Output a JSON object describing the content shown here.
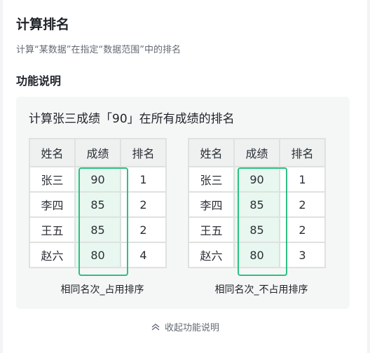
{
  "header": {
    "title": "计算排名",
    "subtitle": "计算“某数据”在指定“数据范围”中的排名"
  },
  "section": {
    "title": "功能说明"
  },
  "example": {
    "title": "计算张三成绩「90」在所有成绩的排名",
    "headers": [
      "姓名",
      "成绩",
      "排名"
    ],
    "table1": {
      "caption": "相同名次_占用排序",
      "rows": [
        [
          "张三",
          "90",
          "1"
        ],
        [
          "李四",
          "85",
          "2"
        ],
        [
          "王五",
          "85",
          "2"
        ],
        [
          "赵六",
          "80",
          "4"
        ]
      ]
    },
    "table2": {
      "caption": "相同名次_不占用排序",
      "rows": [
        [
          "张三",
          "90",
          "1"
        ],
        [
          "李四",
          "85",
          "2"
        ],
        [
          "王五",
          "85",
          "2"
        ],
        [
          "赵六",
          "80",
          "3"
        ]
      ]
    },
    "highlight_color": "#2ebf84"
  },
  "footer": {
    "collapse_label": "收起功能说明",
    "collapse_icon": "chevron-up-double-icon"
  }
}
